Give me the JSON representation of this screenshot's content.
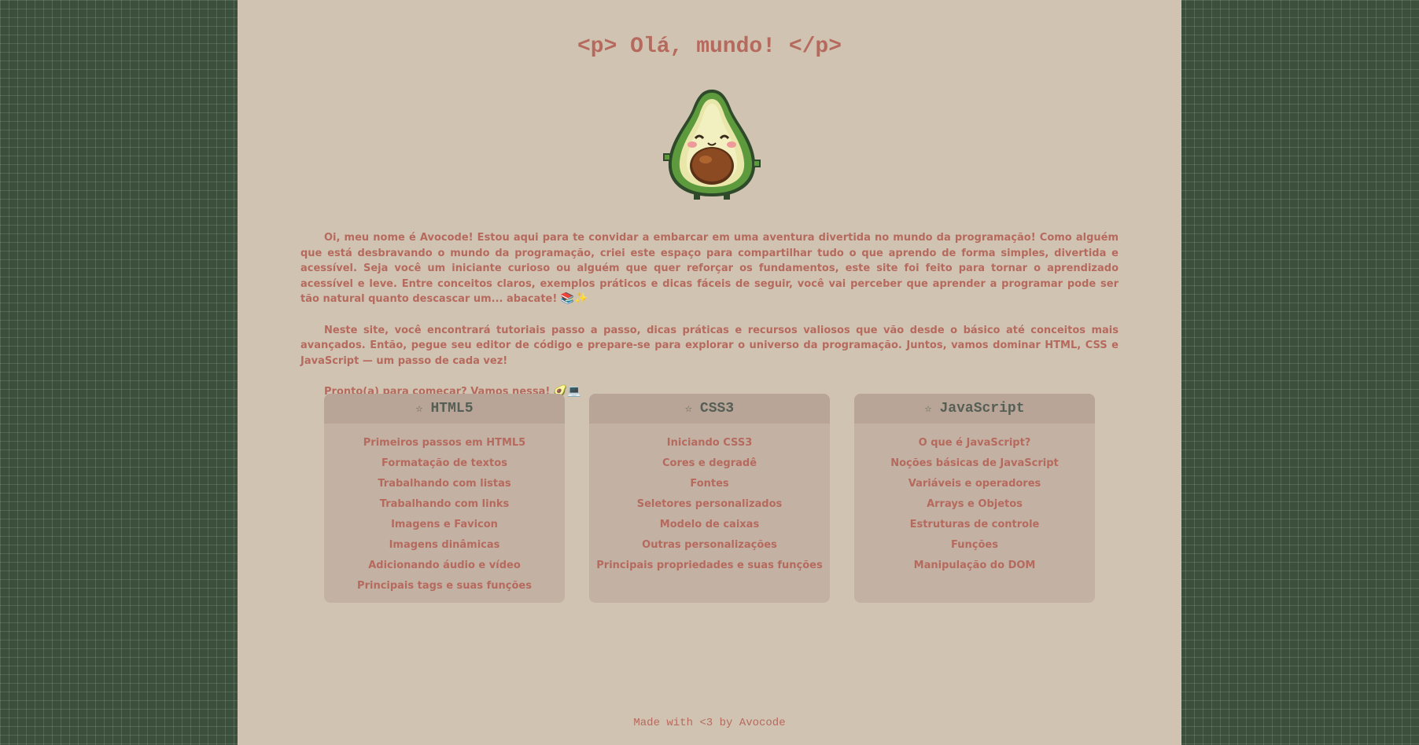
{
  "page": {
    "title": "<p> Olá, mundo! </p>",
    "footer": "Made with <3 by Avocode"
  },
  "intro": {
    "paragraph1": "Oi, meu nome é Avocode! Estou aqui para te convidar a embarcar em uma aventura divertida no mundo da programação! Como alguém que está desbravando o mundo da programação, criei este espaço para compartilhar tudo o que aprendo de forma simples, divertida e acessível. Seja você um iniciante curioso ou alguém que quer reforçar os fundamentos, este site foi feito para tornar o aprendizado acessível e leve. Entre conceitos claros, exemplos práticos e dicas fáceis de seguir, você vai perceber que aprender a programar pode ser tão natural quanto descascar um... abacate!",
    "paragraph1_emoji": "📚✨",
    "paragraph2": "Neste site, você encontrará tutoriais passo a passo, dicas práticas e recursos valiosos que vão desde o básico até conceitos mais avançados. Então, pegue seu editor de código e prepare-se para explorar o universo da programação. Juntos, vamos dominar HTML, CSS e JavaScript — um passo de cada vez!",
    "paragraph3": "Pronto(a) para começar? Vamos nessa!",
    "paragraph3_emoji": "🥑💻"
  },
  "cards": [
    {
      "title": "HTML5",
      "icon": "star-icon",
      "items": [
        "Primeiros passos em HTML5",
        "Formatação de textos",
        "Trabalhando com listas",
        "Trabalhando com links",
        "Imagens e Favicon",
        "Imagens dinâmicas",
        "Adicionando áudio e vídeo",
        "Principais tags e suas funções"
      ]
    },
    {
      "title": "CSS3",
      "icon": "star-icon",
      "items": [
        "Iniciando CSS3",
        "Cores e degradê",
        "Fontes",
        "Seletores personalizados",
        "Modelo de caixas",
        "Outras personalizações",
        "Principais propriedades e suas funções"
      ]
    },
    {
      "title": "JavaScript",
      "icon": "star-icon",
      "items": [
        "O que é JavaScript?",
        "Noções básicas de JavaScript",
        "Variáveis e operadores",
        "Arrays e Objetos",
        "Estruturas de controle",
        "Funções",
        "Manipulação do DOM"
      ]
    }
  ],
  "colors": {
    "background": "#3b4f3c",
    "page": "#d0c3b2",
    "text_accent": "#b66a5e",
    "card": "#c3b1a3",
    "card_header": "#b9a597",
    "card_title": "#555f55"
  }
}
